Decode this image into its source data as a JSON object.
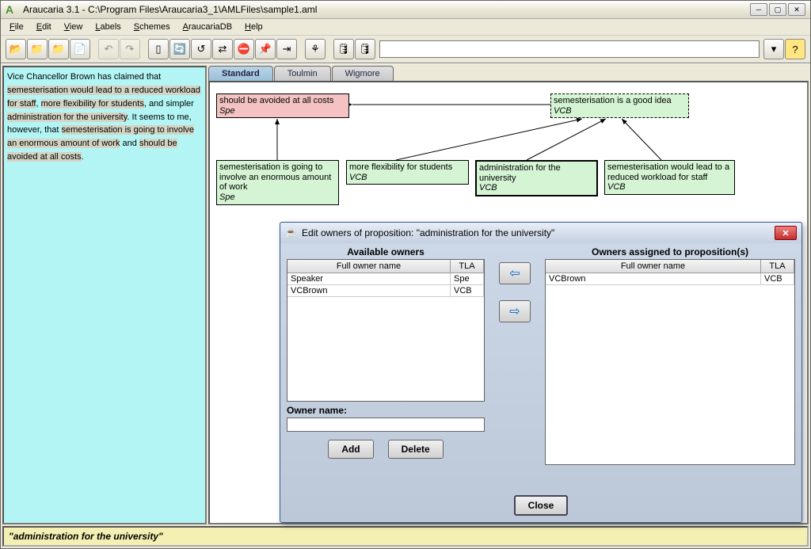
{
  "app": {
    "title": "Araucaria 3.1  -  C:\\Program Files\\Araucaria3_1\\AMLFiles\\sample1.aml"
  },
  "menus": [
    "File",
    "Edit",
    "View",
    "Labels",
    "Schemes",
    "AraucariaDB",
    "Help"
  ],
  "text_panel": {
    "pre1": "Vice Chancellor Brown has claimed that ",
    "hl1": "semesterisation would lead to a reduced workload for staff",
    "mid1": ", ",
    "hl2": "more flexibility for students",
    "mid2": ", and simpler ",
    "hl3": "administration for the university",
    "mid3": ". It seems to me, however, that ",
    "hl4": "semesterisation is going to involve an enormous amount of work",
    "mid4": " and ",
    "hl5": "should be avoided at all costs",
    "post": "."
  },
  "tabs": {
    "t1": "Standard",
    "t2": "Toulmin",
    "t3": "Wigmore"
  },
  "nodes": {
    "n1": {
      "text": "should be avoided at all costs",
      "owner": "Spe"
    },
    "n2": {
      "text": "semesterisation is a good idea",
      "owner": "VCB"
    },
    "n3": {
      "text": "semesterisation is going to involve an enormous amount of work",
      "owner": "Spe"
    },
    "n4": {
      "text": "more flexibility for students",
      "owner": "VCB"
    },
    "n5": {
      "text": "administration for the university",
      "owner": "VCB"
    },
    "n6": {
      "text": "semesterisation would lead to a reduced workload for staff",
      "owner": "VCB"
    }
  },
  "dialog": {
    "title": "Edit owners of proposition: \"administration for the university\"",
    "available_header": "Available owners",
    "assigned_header": "Owners assigned to proposition(s)",
    "col_name": "Full owner name",
    "col_tla": "TLA",
    "available": [
      {
        "name": "Speaker",
        "tla": "Spe"
      },
      {
        "name": "VCBrown",
        "tla": "VCB"
      }
    ],
    "assigned": [
      {
        "name": "VCBrown",
        "tla": "VCB"
      }
    ],
    "owner_label": "Owner name:",
    "add": "Add",
    "delete": "Delete",
    "close": "Close"
  },
  "status": "\"administration for the university\""
}
